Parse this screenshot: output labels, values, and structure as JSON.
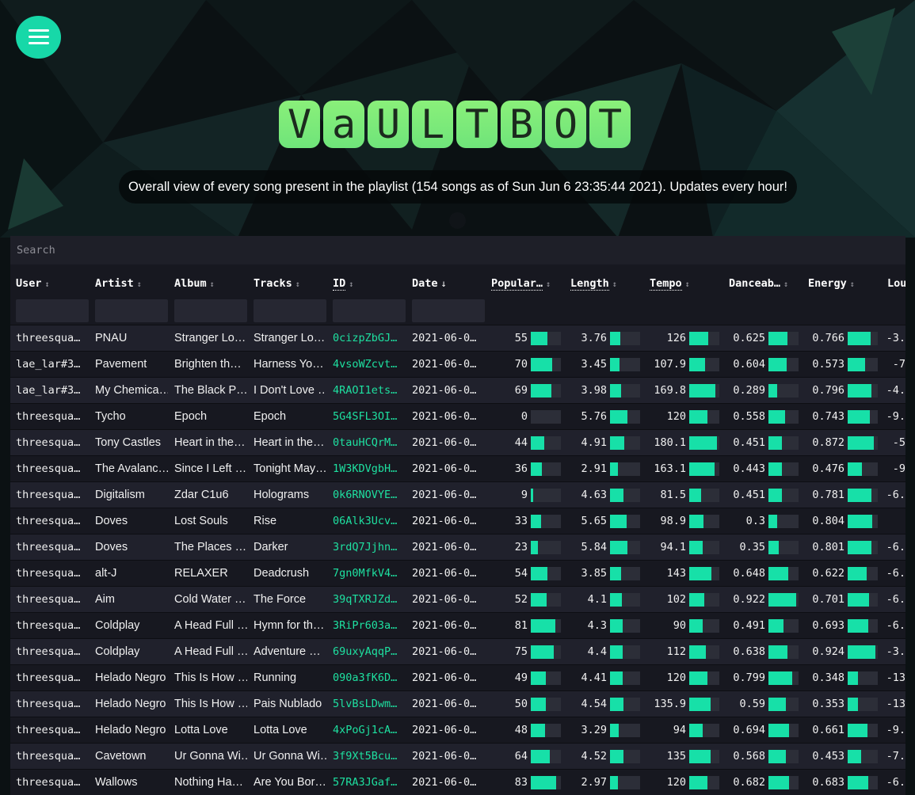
{
  "app": {
    "logo_letters": [
      "V",
      "a",
      "U",
      "L",
      "T",
      "B",
      "O",
      "T"
    ],
    "subtitle": "Overall view of every song present in the playlist (154 songs as of Sun Jun 6 23:35:44 2021). Updates every hour!"
  },
  "colors": {
    "accent": "#17e0a8",
    "logo_green": "#7ee97a",
    "background": "#0c1214",
    "table_bg": "#171820"
  },
  "menu": {
    "icon": "hamburger-menu-icon"
  },
  "search": {
    "placeholder": "Search",
    "value": ""
  },
  "table": {
    "columns": [
      {
        "key": "user",
        "label": "User",
        "sort": "↕",
        "sortable_style": "plain"
      },
      {
        "key": "artist",
        "label": "Artist",
        "sort": "↕",
        "sortable_style": "plain"
      },
      {
        "key": "album",
        "label": "Album",
        "sort": "↕",
        "sortable_style": "plain"
      },
      {
        "key": "tracks",
        "label": "Tracks",
        "sort": "↕",
        "sortable_style": "plain"
      },
      {
        "key": "id",
        "label": "ID",
        "sort": "↕",
        "sortable_style": "dotted"
      },
      {
        "key": "date",
        "label": "Date",
        "sort": "↓",
        "sortable_style": "plain"
      },
      {
        "key": "popularity",
        "label": "Popular…",
        "sort": "↕",
        "sortable_style": "dotted"
      },
      {
        "key": "length",
        "label": "Length",
        "sort": "↕",
        "sortable_style": "dotted"
      },
      {
        "key": "tempo",
        "label": "Tempo",
        "sort": "↕",
        "sortable_style": "dotted"
      },
      {
        "key": "danceability",
        "label": "Danceab…",
        "sort": "↕",
        "sortable_style": "plain"
      },
      {
        "key": "energy",
        "label": "Energy",
        "sort": "↕",
        "sortable_style": "plain"
      },
      {
        "key": "loudness",
        "label": "Lou",
        "sort": "",
        "sortable_style": "plain"
      }
    ],
    "rows": [
      {
        "user": "threesqua…",
        "artist": "PNAU",
        "album": "Stranger Lo…",
        "tracks": "Stranger Lo…",
        "id": "0cizpZbGJ…",
        "date": "2021-06-0…",
        "popularity": "55",
        "pop_frac": 0.55,
        "length": "3.76",
        "len_frac": 0.35,
        "tempo": "126",
        "tempo_frac": 0.62,
        "dance": "0.625",
        "dance_frac": 0.625,
        "energy": "0.766",
        "energy_frac": 0.766,
        "loudness": "-3."
      },
      {
        "user": "lae_lar#3…",
        "artist": "Pavement",
        "album": "Brighten th…",
        "tracks": "Harness Yo…",
        "id": "4vsoWZcvt…",
        "date": "2021-06-0…",
        "popularity": "70",
        "pop_frac": 0.7,
        "length": "3.45",
        "len_frac": 0.32,
        "tempo": "107.9",
        "tempo_frac": 0.52,
        "dance": "0.604",
        "dance_frac": 0.604,
        "energy": "0.573",
        "energy_frac": 0.573,
        "loudness": "-7"
      },
      {
        "user": "lae_lar#3…",
        "artist": "My Chemica…",
        "album": "The Black P…",
        "tracks": "I Don't Love …",
        "id": "4RAOI1ets…",
        "date": "2021-06-0…",
        "popularity": "69",
        "pop_frac": 0.69,
        "length": "3.98",
        "len_frac": 0.38,
        "tempo": "169.8",
        "tempo_frac": 0.88,
        "dance": "0.289",
        "dance_frac": 0.289,
        "energy": "0.796",
        "energy_frac": 0.796,
        "loudness": "-4."
      },
      {
        "user": "threesqua…",
        "artist": "Tycho",
        "album": "Epoch",
        "tracks": "Epoch",
        "id": "5G4SFL3OI…",
        "date": "2021-06-0…",
        "popularity": "0",
        "pop_frac": 0.0,
        "length": "5.76",
        "len_frac": 0.57,
        "tempo": "120",
        "tempo_frac": 0.6,
        "dance": "0.558",
        "dance_frac": 0.558,
        "energy": "0.743",
        "energy_frac": 0.743,
        "loudness": "-9."
      },
      {
        "user": "threesqua…",
        "artist": "Tony Castles",
        "album": "Heart in the…",
        "tracks": "Heart in the…",
        "id": "0tauHCQrM…",
        "date": "2021-06-0…",
        "popularity": "44",
        "pop_frac": 0.44,
        "length": "4.91",
        "len_frac": 0.47,
        "tempo": "180.1",
        "tempo_frac": 0.92,
        "dance": "0.451",
        "dance_frac": 0.451,
        "energy": "0.872",
        "energy_frac": 0.872,
        "loudness": "-5"
      },
      {
        "user": "threesqua…",
        "artist": "The Avalanc…",
        "album": "Since I Left …",
        "tracks": "Tonight May…",
        "id": "1W3KDVgbH…",
        "date": "2021-06-0…",
        "popularity": "36",
        "pop_frac": 0.36,
        "length": "2.91",
        "len_frac": 0.25,
        "tempo": "163.1",
        "tempo_frac": 0.85,
        "dance": "0.443",
        "dance_frac": 0.443,
        "energy": "0.476",
        "energy_frac": 0.476,
        "loudness": "-9"
      },
      {
        "user": "threesqua…",
        "artist": "Digitalism",
        "album": "Zdar C1u6",
        "tracks": "Holograms",
        "id": "0k6RNOVYE…",
        "date": "2021-06-0…",
        "popularity": "9",
        "pop_frac": 0.09,
        "length": "4.63",
        "len_frac": 0.45,
        "tempo": "81.5",
        "tempo_frac": 0.4,
        "dance": "0.451",
        "dance_frac": 0.451,
        "energy": "0.781",
        "energy_frac": 0.781,
        "loudness": "-6."
      },
      {
        "user": "threesqua…",
        "artist": "Doves",
        "album": "Lost Souls",
        "tracks": "Rise",
        "id": "06Alk3Ucv…",
        "date": "2021-06-0…",
        "popularity": "33",
        "pop_frac": 0.33,
        "length": "5.65",
        "len_frac": 0.56,
        "tempo": "98.9",
        "tempo_frac": 0.48,
        "dance": "0.3",
        "dance_frac": 0.3,
        "energy": "0.804",
        "energy_frac": 0.804,
        "loudness": ""
      },
      {
        "user": "threesqua…",
        "artist": "Doves",
        "album": "The Places …",
        "tracks": "Darker",
        "id": "3rdQ7Jjhn…",
        "date": "2021-06-0…",
        "popularity": "23",
        "pop_frac": 0.23,
        "length": "5.84",
        "len_frac": 0.58,
        "tempo": "94.1",
        "tempo_frac": 0.46,
        "dance": "0.35",
        "dance_frac": 0.35,
        "energy": "0.801",
        "energy_frac": 0.801,
        "loudness": "-6."
      },
      {
        "user": "threesqua…",
        "artist": "alt-J",
        "album": "RELAXER",
        "tracks": "Deadcrush",
        "id": "7gn0MfkV4…",
        "date": "2021-06-0…",
        "popularity": "54",
        "pop_frac": 0.54,
        "length": "3.85",
        "len_frac": 0.37,
        "tempo": "143",
        "tempo_frac": 0.73,
        "dance": "0.648",
        "dance_frac": 0.648,
        "energy": "0.622",
        "energy_frac": 0.622,
        "loudness": "-6."
      },
      {
        "user": "threesqua…",
        "artist": "Aim",
        "album": "Cold Water …",
        "tracks": "The Force",
        "id": "39qTXRJZd…",
        "date": "2021-06-0…",
        "popularity": "52",
        "pop_frac": 0.52,
        "length": "4.1",
        "len_frac": 0.39,
        "tempo": "102",
        "tempo_frac": 0.5,
        "dance": "0.922",
        "dance_frac": 0.922,
        "energy": "0.701",
        "energy_frac": 0.701,
        "loudness": "-6."
      },
      {
        "user": "threesqua…",
        "artist": "Coldplay",
        "album": "A Head Full …",
        "tracks": "Hymn for th…",
        "id": "3RiPr603a…",
        "date": "2021-06-0…",
        "popularity": "81",
        "pop_frac": 0.81,
        "length": "4.3",
        "len_frac": 0.41,
        "tempo": "90",
        "tempo_frac": 0.44,
        "dance": "0.491",
        "dance_frac": 0.491,
        "energy": "0.693",
        "energy_frac": 0.693,
        "loudness": "-6."
      },
      {
        "user": "threesqua…",
        "artist": "Coldplay",
        "album": "A Head Full …",
        "tracks": "Adventure …",
        "id": "69uxyAqqP…",
        "date": "2021-06-0…",
        "popularity": "75",
        "pop_frac": 0.75,
        "length": "4.4",
        "len_frac": 0.42,
        "tempo": "112",
        "tempo_frac": 0.56,
        "dance": "0.638",
        "dance_frac": 0.638,
        "energy": "0.924",
        "energy_frac": 0.924,
        "loudness": "-3."
      },
      {
        "user": "threesqua…",
        "artist": "Helado Negro",
        "album": "This Is How …",
        "tracks": "Running",
        "id": "090a3fK6D…",
        "date": "2021-06-0…",
        "popularity": "49",
        "pop_frac": 0.49,
        "length": "4.41",
        "len_frac": 0.42,
        "tempo": "120",
        "tempo_frac": 0.6,
        "dance": "0.799",
        "dance_frac": 0.799,
        "energy": "0.348",
        "energy_frac": 0.348,
        "loudness": "-13"
      },
      {
        "user": "threesqua…",
        "artist": "Helado Negro",
        "album": "This Is How …",
        "tracks": "Pais Nublado",
        "id": "5lvBsLDwm…",
        "date": "2021-06-0…",
        "popularity": "50",
        "pop_frac": 0.5,
        "length": "4.54",
        "len_frac": 0.44,
        "tempo": "135.9",
        "tempo_frac": 0.7,
        "dance": "0.59",
        "dance_frac": 0.59,
        "energy": "0.353",
        "energy_frac": 0.353,
        "loudness": "-13"
      },
      {
        "user": "threesqua…",
        "artist": "Helado Negro",
        "album": "Lotta Love",
        "tracks": "Lotta Love",
        "id": "4xPoGj1cA…",
        "date": "2021-06-0…",
        "popularity": "48",
        "pop_frac": 0.48,
        "length": "3.29",
        "len_frac": 0.3,
        "tempo": "94",
        "tempo_frac": 0.46,
        "dance": "0.694",
        "dance_frac": 0.694,
        "energy": "0.661",
        "energy_frac": 0.661,
        "loudness": "-9."
      },
      {
        "user": "threesqua…",
        "artist": "Cavetown",
        "album": "Ur Gonna Wi…",
        "tracks": "Ur Gonna Wi…",
        "id": "3f9Xt5Bcu…",
        "date": "2021-06-0…",
        "popularity": "64",
        "pop_frac": 0.64,
        "length": "4.52",
        "len_frac": 0.44,
        "tempo": "135",
        "tempo_frac": 0.7,
        "dance": "0.568",
        "dance_frac": 0.568,
        "energy": "0.453",
        "energy_frac": 0.453,
        "loudness": "-7."
      },
      {
        "user": "threesqua…",
        "artist": "Wallows",
        "album": "Nothing Ha…",
        "tracks": "Are You Bor…",
        "id": "57RA3JGaf…",
        "date": "2021-06-0…",
        "popularity": "83",
        "pop_frac": 0.83,
        "length": "2.97",
        "len_frac": 0.26,
        "tempo": "120",
        "tempo_frac": 0.6,
        "dance": "0.682",
        "dance_frac": 0.682,
        "energy": "0.683",
        "energy_frac": 0.683,
        "loudness": "-6."
      }
    ]
  }
}
